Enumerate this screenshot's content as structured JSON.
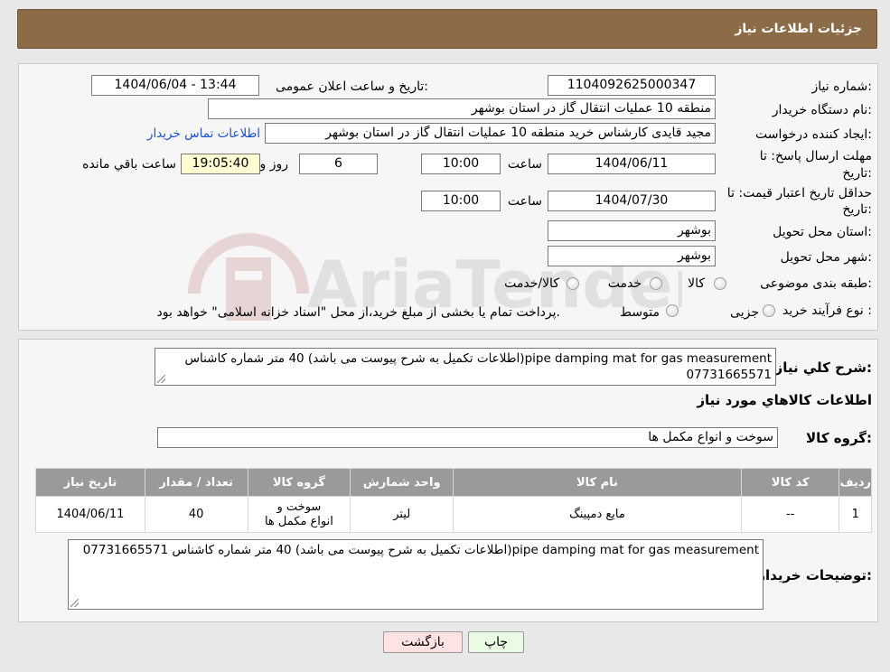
{
  "header": {
    "title": "جزئیات اطلاعات نیاز"
  },
  "form": {
    "need_number_label": "شماره نیاز:",
    "need_number": "1104092625000347",
    "announce_label": "تاریخ و ساعت اعلان عمومی:",
    "announce_value": "1404/06/04 - 13:44",
    "buyer_org_label": "نام دستگاه خریدار:",
    "buyer_org": "منطقه 10 عملیات انتقال گاز در استان بوشهر",
    "requester_label": "ایجاد کننده درخواست:",
    "requester": "مجید قایدی کارشناس خرید منطقه 10 عملیات انتقال گاز در استان بوشهر",
    "contact_link": "اطلاعات تماس خریدار",
    "deadline_label_1": "مهلت ارسال پاسخ: تا",
    "deadline_label_2": "تاریخ:",
    "deadline_date": "1404/06/11",
    "time_label": "ساعت",
    "deadline_time": "10:00",
    "days_value": "6",
    "days_label": "روز و",
    "remaining_time": "19:05:40",
    "remaining_label": "ساعت باقي مانده",
    "validity_label_1": "حداقل تاریخ اعتبار قیمت: تا",
    "validity_label_2": "تاریخ:",
    "validity_date": "1404/07/30",
    "validity_time": "10:00",
    "province_label": "استان محل تحویل:",
    "province": "بوشهر",
    "city_label": "شهر محل تحویل:",
    "city": "بوشهر",
    "category_label": "طبقه بندی موضوعی:",
    "category_options": [
      "کالا",
      "خدمت",
      "کالا/خدمت"
    ],
    "process_label": "نوع فرآیند خرید :",
    "process_options": [
      "جزیی",
      "متوسط"
    ],
    "process_note": "پرداخت تمام یا بخشی از مبلغ خرید،از محل \"اسناد خزانه اسلامی\" خواهد بود."
  },
  "summary": {
    "label": "شرح کلي نياز:",
    "text": "pipe damping mat for gas measurement(اطلاعات تکمیل به شرح پیوست می باشد) 40 متر شماره کاشناس 07731665571",
    "items_title": "اطلاعات کالاهاي مورد نياز",
    "group_label": "گروه کالا:",
    "group_value": "سوخت و انواع مکمل ها"
  },
  "table": {
    "headers": [
      "ردیف",
      "کد کالا",
      "نام کالا",
      "واحد شمارش",
      "گروه کالا",
      "تعداد / مقدار",
      "تاریخ نیاز"
    ],
    "rows": [
      [
        "1",
        "--",
        "مایع دمپینگ",
        "لیتر",
        "سوخت و انواع مکمل ها",
        "40",
        "1404/06/11"
      ]
    ]
  },
  "buyer_notes": {
    "label": "توضیحات خریدار:",
    "text": "pipe damping mat for gas measurement(اطلاعات تکمیل به شرح پیوست می باشد) 40 متر شماره کاشناس 07731665571"
  },
  "buttons": {
    "print": "چاپ",
    "back": "بازگشت"
  },
  "colors": {
    "header_bg": "#8b6c46",
    "link": "#1a4fd0",
    "back_btn": "#ffe3e3",
    "print_btn": "#e9fbe3",
    "timer_bg": "#fffbd2"
  },
  "watermark": "AriaTender.neT"
}
